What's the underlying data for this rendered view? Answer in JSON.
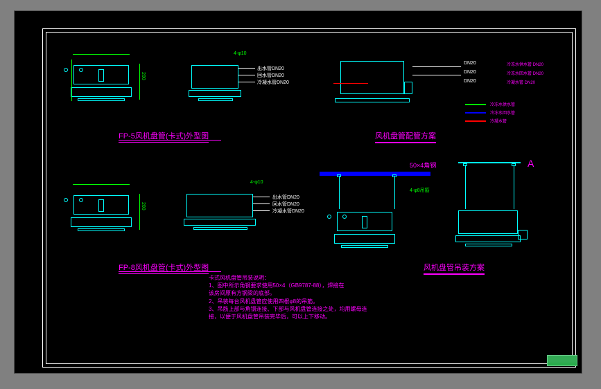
{
  "dimensions": {
    "holes": "4-φ10",
    "pipe_out": "出水管DN20",
    "pipe_in": "回水管DN20",
    "pipe_cond": "冷凝水管DN20",
    "angle": "50×4角钢",
    "hanger_rod": "4-φ8吊筋",
    "detail_mark": "A"
  },
  "titles": {
    "fp5": "FP-5风机盘管(卡式)外型图",
    "fp8": "FP-8风机盘管(卡式)外型图",
    "piping": "风机盘管配管方案",
    "hanging": "风机盘管吊装方案"
  },
  "piping_legend": {
    "row1": "DN20",
    "row2": "DN20",
    "row3": "DN20",
    "far1": "冷冻水供水管 DN20",
    "far2": "冷冻水回水管 DN20",
    "far3": "冷凝水管 DN20",
    "type1": "冷冻水供水管",
    "type2": "冷冻水回水管",
    "type3": "冷凝水管"
  },
  "notes": {
    "head": "卡式风机盘管吊装说明：",
    "l1": "1、图中所示角钢要求使用50×4（GB9787-88），焊接在",
    "l1b": "    该房间原有方钢梁的底部。",
    "l2": "2、吊装每台风机盘管应使用四根φ8的吊筋。",
    "l3": "3、吊筋上部与角钢连接、下部与风机盘管连接之处，均用螺母连",
    "l3b": "    接，以便于风机盘管吊装完毕后，可以上下移动。"
  }
}
